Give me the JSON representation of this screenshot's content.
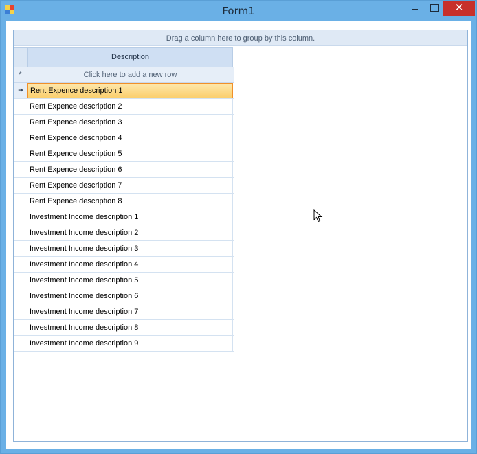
{
  "window": {
    "title": "Form1",
    "close_glyph": "✕",
    "accent": "#6ab0e6",
    "close_color": "#c7302b"
  },
  "grid": {
    "group_panel_text": "Drag a column here to group by this column.",
    "columns": [
      "Description"
    ],
    "new_row_indicator": "*",
    "new_row_text": "Click here to add a new row",
    "focused_row_indicator": "➔",
    "focused_color": "#fbcf6e",
    "rows": [
      "Rent Expence description 1",
      "Rent Expence description 2",
      "Rent Expence description 3",
      "Rent Expence description 4",
      "Rent Expence description 5",
      "Rent Expence description 6",
      "Rent Expence description 7",
      "Rent Expence description 8",
      "Investment Income description 1",
      "Investment Income description 2",
      "Investment Income description 3",
      "Investment Income description 4",
      "Investment Income description 5",
      "Investment Income description 6",
      "Investment Income description 7",
      "Investment Income description 8",
      "Investment Income description 9"
    ]
  },
  "icons": {
    "app": "form-app-icon",
    "minimize": "minimize-icon",
    "maximize": "maximize-icon",
    "close": "close-icon",
    "cursor": "mouse-pointer-icon"
  }
}
